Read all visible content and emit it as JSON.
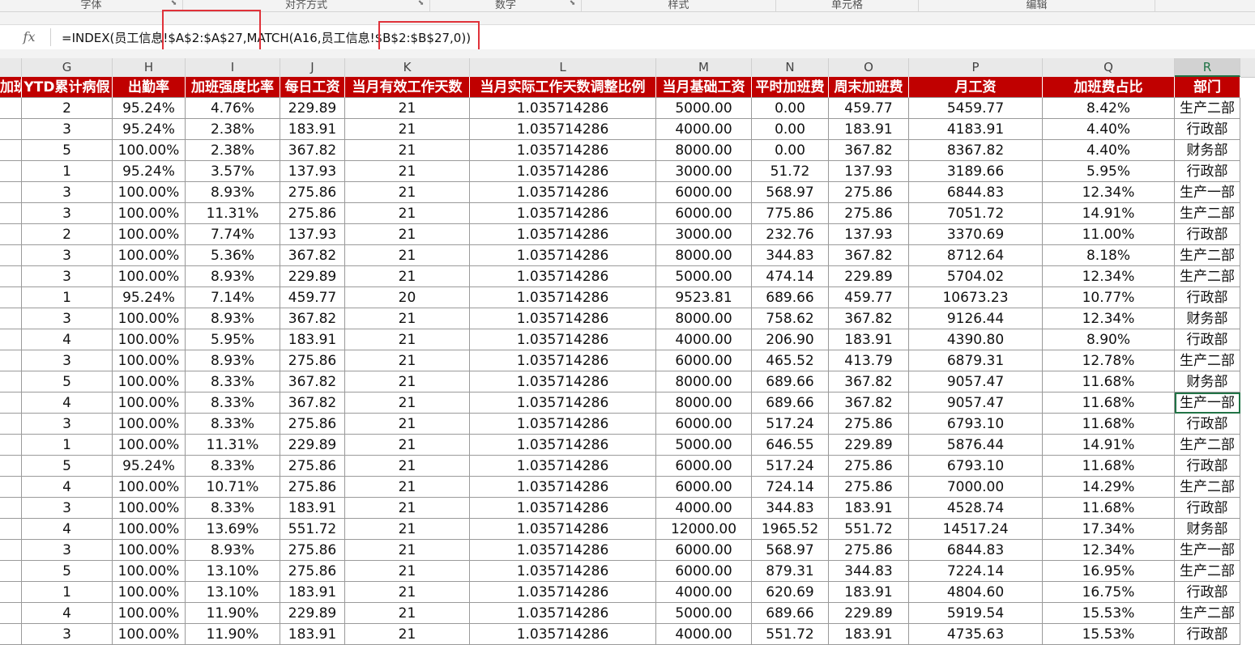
{
  "ribbon": {
    "groups": [
      {
        "label": "字体"
      },
      {
        "label": "对齐方式"
      },
      {
        "label": "数字"
      },
      {
        "label": "样式"
      },
      {
        "label": "单元格"
      },
      {
        "label": "编辑"
      }
    ]
  },
  "formula_bar": {
    "fx_label": "fx",
    "formula": "=INDEX(员工信息!$A$2:$A$27,MATCH(A16,员工信息!$B$2:$B$27,0))"
  },
  "columns": [
    "G",
    "H",
    "I",
    "J",
    "K",
    "L",
    "M",
    "N",
    "O",
    "P",
    "Q",
    "R"
  ],
  "selected_column": "R",
  "header_row": [
    "加班",
    "YTD累计病假",
    "出勤率",
    "加班强度比率",
    "每日工资",
    "当月有效工作天数",
    "当月实际工作天数调整比例",
    "当月基础工资",
    "平时加班费",
    "周末加班费",
    "月工资",
    "加班费占比",
    "部门"
  ],
  "rows": [
    [
      "",
      "2",
      "95.24%",
      "4.76%",
      "229.89",
      "21",
      "1.035714286",
      "5000.00",
      "0.00",
      "459.77",
      "5459.77",
      "8.42%",
      "生产二部"
    ],
    [
      "",
      "3",
      "95.24%",
      "2.38%",
      "183.91",
      "21",
      "1.035714286",
      "4000.00",
      "0.00",
      "183.91",
      "4183.91",
      "4.40%",
      "行政部"
    ],
    [
      "",
      "5",
      "100.00%",
      "2.38%",
      "367.82",
      "21",
      "1.035714286",
      "8000.00",
      "0.00",
      "367.82",
      "8367.82",
      "4.40%",
      "财务部"
    ],
    [
      "",
      "1",
      "95.24%",
      "3.57%",
      "137.93",
      "21",
      "1.035714286",
      "3000.00",
      "51.72",
      "137.93",
      "3189.66",
      "5.95%",
      "行政部"
    ],
    [
      "",
      "3",
      "100.00%",
      "8.93%",
      "275.86",
      "21",
      "1.035714286",
      "6000.00",
      "568.97",
      "275.86",
      "6844.83",
      "12.34%",
      "生产一部"
    ],
    [
      "",
      "3",
      "100.00%",
      "11.31%",
      "275.86",
      "21",
      "1.035714286",
      "6000.00",
      "775.86",
      "275.86",
      "7051.72",
      "14.91%",
      "生产二部"
    ],
    [
      "",
      "2",
      "100.00%",
      "7.74%",
      "137.93",
      "21",
      "1.035714286",
      "3000.00",
      "232.76",
      "137.93",
      "3370.69",
      "11.00%",
      "行政部"
    ],
    [
      "",
      "3",
      "100.00%",
      "5.36%",
      "367.82",
      "21",
      "1.035714286",
      "8000.00",
      "344.83",
      "367.82",
      "8712.64",
      "8.18%",
      "生产二部"
    ],
    [
      "",
      "3",
      "100.00%",
      "8.93%",
      "229.89",
      "21",
      "1.035714286",
      "5000.00",
      "474.14",
      "229.89",
      "5704.02",
      "12.34%",
      "生产二部"
    ],
    [
      "",
      "1",
      "95.24%",
      "7.14%",
      "459.77",
      "20",
      "1.035714286",
      "9523.81",
      "689.66",
      "459.77",
      "10673.23",
      "10.77%",
      "行政部"
    ],
    [
      "",
      "3",
      "100.00%",
      "8.93%",
      "367.82",
      "21",
      "1.035714286",
      "8000.00",
      "758.62",
      "367.82",
      "9126.44",
      "12.34%",
      "财务部"
    ],
    [
      "",
      "4",
      "100.00%",
      "5.95%",
      "183.91",
      "21",
      "1.035714286",
      "4000.00",
      "206.90",
      "183.91",
      "4390.80",
      "8.90%",
      "行政部"
    ],
    [
      "",
      "3",
      "100.00%",
      "8.93%",
      "275.86",
      "21",
      "1.035714286",
      "6000.00",
      "465.52",
      "413.79",
      "6879.31",
      "12.78%",
      "生产二部"
    ],
    [
      "",
      "5",
      "100.00%",
      "8.33%",
      "367.82",
      "21",
      "1.035714286",
      "8000.00",
      "689.66",
      "367.82",
      "9057.47",
      "11.68%",
      "财务部"
    ],
    [
      "",
      "4",
      "100.00%",
      "8.33%",
      "367.82",
      "21",
      "1.035714286",
      "8000.00",
      "689.66",
      "367.82",
      "9057.47",
      "11.68%",
      "生产一部"
    ],
    [
      "",
      "3",
      "100.00%",
      "8.33%",
      "275.86",
      "21",
      "1.035714286",
      "6000.00",
      "517.24",
      "275.86",
      "6793.10",
      "11.68%",
      "行政部"
    ],
    [
      "",
      "1",
      "100.00%",
      "11.31%",
      "229.89",
      "21",
      "1.035714286",
      "5000.00",
      "646.55",
      "229.89",
      "5876.44",
      "14.91%",
      "生产二部"
    ],
    [
      "",
      "5",
      "95.24%",
      "8.33%",
      "275.86",
      "21",
      "1.035714286",
      "6000.00",
      "517.24",
      "275.86",
      "6793.10",
      "11.68%",
      "行政部"
    ],
    [
      "",
      "4",
      "100.00%",
      "10.71%",
      "275.86",
      "21",
      "1.035714286",
      "6000.00",
      "724.14",
      "275.86",
      "7000.00",
      "14.29%",
      "生产二部"
    ],
    [
      "",
      "3",
      "100.00%",
      "8.33%",
      "183.91",
      "21",
      "1.035714286",
      "4000.00",
      "344.83",
      "183.91",
      "4528.74",
      "11.68%",
      "行政部"
    ],
    [
      "",
      "4",
      "100.00%",
      "13.69%",
      "551.72",
      "21",
      "1.035714286",
      "12000.00",
      "1965.52",
      "551.72",
      "14517.24",
      "17.34%",
      "财务部"
    ],
    [
      "",
      "3",
      "100.00%",
      "8.93%",
      "275.86",
      "21",
      "1.035714286",
      "6000.00",
      "568.97",
      "275.86",
      "6844.83",
      "12.34%",
      "生产一部"
    ],
    [
      "",
      "5",
      "100.00%",
      "13.10%",
      "275.86",
      "21",
      "1.035714286",
      "6000.00",
      "879.31",
      "344.83",
      "7224.14",
      "16.95%",
      "生产二部"
    ],
    [
      "",
      "1",
      "100.00%",
      "13.10%",
      "183.91",
      "21",
      "1.035714286",
      "4000.00",
      "620.69",
      "183.91",
      "4804.60",
      "16.75%",
      "行政部"
    ],
    [
      "",
      "4",
      "100.00%",
      "11.90%",
      "229.89",
      "21",
      "1.035714286",
      "5000.00",
      "689.66",
      "229.89",
      "5919.54",
      "15.53%",
      "生产二部"
    ],
    [
      "",
      "3",
      "100.00%",
      "11.90%",
      "183.91",
      "21",
      "1.035714286",
      "4000.00",
      "551.72",
      "183.91",
      "4735.63",
      "15.53%",
      "行政部"
    ]
  ],
  "active_cell": {
    "row": 14,
    "col": 12
  },
  "colors": {
    "header_bg": "#c00000",
    "header_text": "#ffffff",
    "highlight_box": "#e0323a",
    "selection": "#217346"
  }
}
